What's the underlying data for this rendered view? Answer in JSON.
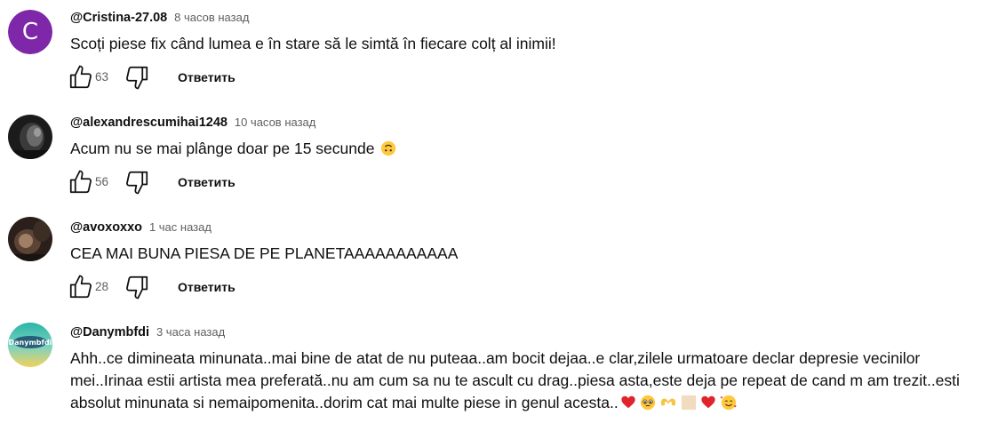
{
  "comments": [
    {
      "author": "@Cristina-27.08",
      "time": "8 часов назад",
      "text": "Scoți piese fix când lumea e în stare să le simtă în fiecare colț al inimii!",
      "likes": "63",
      "reply_label": "Ответить",
      "avatar_letter": "C",
      "avatar_color": "#7e27a8"
    },
    {
      "author": "@alexandrescumihai1248",
      "time": "10 часов назад",
      "text": "Acum nu se mai plânge doar pe 15 secunde",
      "likes": "56",
      "reply_label": "Ответить"
    },
    {
      "author": "@avoxoxxo",
      "time": "1 час назад",
      "text": "CEA MAI BUNA PIESA DE PE PLANETAAAAAAAAAAA",
      "likes": "28",
      "reply_label": "Ответить"
    },
    {
      "author": "@Danymbfdi",
      "time": "3 часа назад",
      "text": "Ahh..ce dimineata minunata..mai bine de atat de nu puteaa..am bocit dejaa..e clar,zilele urmatoare declar depresie vecinilor mei..Irinaa estii artista mea preferată..nu am cum sa nu te ascult cu drag..piesa asta,este deja pe repeat de cand m am trezit..esti absolut minunata si nemaipomenita..dorim cat mai multe piese in genul acesta..",
      "avatar_logo_text": "Danymbfdi"
    }
  ],
  "colors": {
    "text": "#0f0f0f",
    "secondary": "#606060",
    "heart": "#e0242c"
  },
  "icons": [
    "thumbs-up-icon",
    "thumbs-down-icon",
    "upside-down-face-emoji",
    "red-heart-emoji",
    "pleading-face-emoji",
    "heart-hands-emoji",
    "beige-square-emoji",
    "smiling-face-with-hearts-emoji"
  ]
}
